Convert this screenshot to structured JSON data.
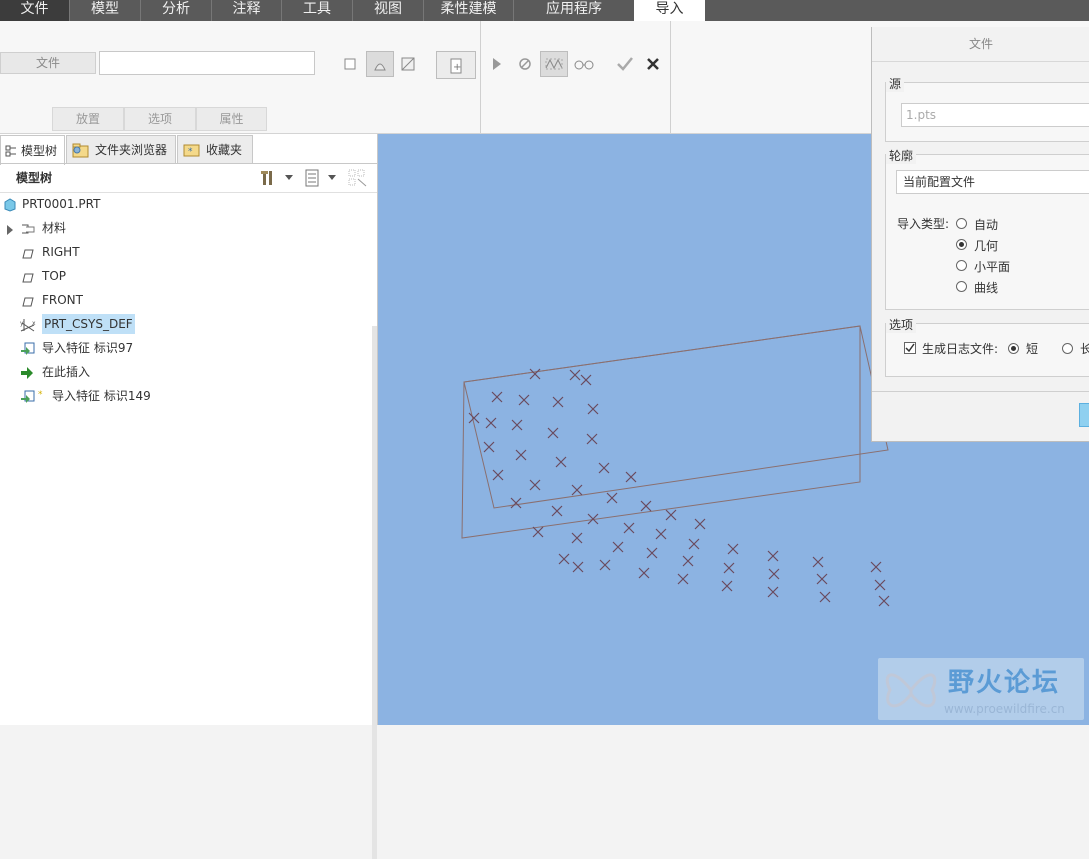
{
  "menubar": {
    "tabs": [
      {
        "label": "文件",
        "style": "file"
      },
      {
        "label": "模型",
        "style": ""
      },
      {
        "label": "分析",
        "style": ""
      },
      {
        "label": "注释",
        "style": ""
      },
      {
        "label": "工具",
        "style": ""
      },
      {
        "label": "视图",
        "style": ""
      },
      {
        "label": "柔性建模",
        "style": ""
      },
      {
        "label": "应用程序",
        "style": ""
      },
      {
        "label": "导入",
        "style": "active"
      }
    ]
  },
  "ribbon": {
    "file_label": "文件",
    "file_value": "",
    "subtabs": [
      "放置",
      "选项",
      "属性"
    ]
  },
  "panel": {
    "tabs": [
      "模型树",
      "文件夹浏览器",
      "收藏夹"
    ],
    "tree_header": "模型树",
    "items": [
      {
        "label": "PRT0001.PRT",
        "icon": "part-icon"
      },
      {
        "label": "材料",
        "icon": "material-icon"
      },
      {
        "label": "RIGHT",
        "icon": "datum-plane-icon"
      },
      {
        "label": "TOP",
        "icon": "datum-plane-icon"
      },
      {
        "label": "FRONT",
        "icon": "datum-plane-icon"
      },
      {
        "label": "PRT_CSYS_DEF",
        "icon": "csys-icon"
      },
      {
        "label": "导入特征 标识97",
        "icon": "import-feature-icon"
      },
      {
        "label": "在此插入",
        "icon": "insert-here-arrow-icon"
      },
      {
        "label": "导入特征 标识149",
        "icon": "import-feature-new-icon"
      }
    ]
  },
  "dialog": {
    "title": "文件",
    "source_label": "源",
    "source_value": "1.pts",
    "profile_label": "轮廓",
    "profile_value": "当前配置文件",
    "import_type_label": "导入类型:",
    "import_types": [
      "自动",
      "几何",
      "小平面",
      "曲线"
    ],
    "import_type_selected": "几何",
    "options_label": "选项",
    "log_label": "生成日志文件:",
    "log_checked": true,
    "log_short": "短",
    "log_long": "长"
  },
  "watermark": {
    "title": "野火论坛",
    "url": "www.proewildfire.cn"
  },
  "colors": {
    "menubar": "#5a5a5a",
    "graphics_bg": "#8cb3e2",
    "selection": "#bfe0f7",
    "outline": "#8a6f6f",
    "point": "#6a4a5e"
  }
}
